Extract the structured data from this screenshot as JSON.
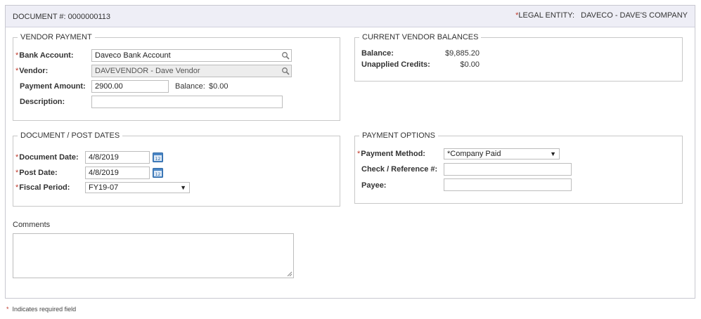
{
  "header": {
    "document_label": "DOCUMENT #:",
    "document_number": "0000000113",
    "legal_entity_label": "LEGAL ENTITY:",
    "legal_entity_value": "DAVECO - DAVE'S COMPANY"
  },
  "vendor_payment": {
    "legend": "VENDOR PAYMENT",
    "bank_account_label": "Bank Account:",
    "bank_account_value": "Daveco Bank Account",
    "vendor_label": "Vendor:",
    "vendor_value": "DAVEVENDOR - Dave Vendor",
    "payment_amount_label": "Payment Amount:",
    "payment_amount_value": "2900.00",
    "balance_label": "Balance:",
    "balance_value": "$0.00",
    "description_label": "Description:",
    "description_value": ""
  },
  "current_vendor_balances": {
    "legend": "CURRENT VENDOR BALANCES",
    "balance_label": "Balance:",
    "balance_value": "$9,885.20",
    "unapplied_label": "Unapplied Credits:",
    "unapplied_value": "$0.00"
  },
  "dates": {
    "legend": "DOCUMENT / POST DATES",
    "document_date_label": "Document Date:",
    "document_date_value": "4/8/2019",
    "post_date_label": "Post Date:",
    "post_date_value": "4/8/2019",
    "fiscal_period_label": "Fiscal Period:",
    "fiscal_period_value": "FY19-07"
  },
  "payment_options": {
    "legend": "PAYMENT OPTIONS",
    "payment_method_label": "Payment Method:",
    "payment_method_value": "*Company Paid",
    "check_ref_label": "Check / Reference #:",
    "check_ref_value": "",
    "payee_label": "Payee:",
    "payee_value": ""
  },
  "comments": {
    "label": "Comments",
    "value": ""
  },
  "footer": {
    "required_note": "Indicates required field"
  },
  "required_marker": "*",
  "icons": {
    "lookup": "search-icon",
    "calendar": "calendar-icon",
    "dropdown": "triangle-down"
  },
  "colors": {
    "required": "#c0392b",
    "header_bg": "#eeeef6",
    "calendar_blue": "#4a86c5"
  }
}
